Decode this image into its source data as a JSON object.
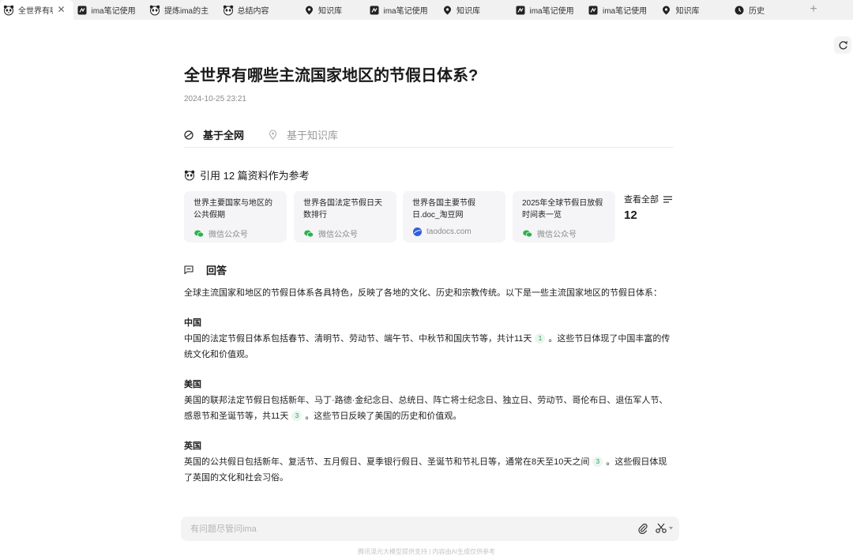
{
  "tabs": [
    {
      "label": "全世界有哪些主流国家地区的节假日体系？",
      "icon": "panda-icon",
      "active": true
    },
    {
      "label": "ima笔记使用指南",
      "icon": "note-icon"
    },
    {
      "label": "提炼ima的主要功能",
      "icon": "panda-icon"
    },
    {
      "label": "总结内容",
      "icon": "panda-icon"
    },
    {
      "label": "知识库",
      "icon": "pin-icon"
    },
    {
      "label": "ima笔记使用指南",
      "icon": "note-icon"
    },
    {
      "label": "知识库",
      "icon": "pin-icon"
    },
    {
      "label": "ima笔记使用指南",
      "icon": "note-icon"
    },
    {
      "label": "ima笔记使用指南",
      "icon": "note-icon"
    },
    {
      "label": "知识库",
      "icon": "pin-icon"
    },
    {
      "label": "历史",
      "icon": "clock-icon"
    }
  ],
  "tab_close": "✕",
  "tab_add": "+",
  "page": {
    "title": "全世界有哪些主流国家地区的节假日体系?",
    "date": "2024-10-25 23:21"
  },
  "source_tabs": {
    "web": "基于全网",
    "kb": "基于知识库"
  },
  "references": {
    "heading": "引用 12 篇资料作为参考",
    "cards": [
      {
        "title": "世界主要国家与地区的公共假期",
        "source": "微信公众号",
        "source_icon": "wechat-icon"
      },
      {
        "title": "世界各国法定节假日天数排行",
        "source": "微信公众号",
        "source_icon": "wechat-icon"
      },
      {
        "title": "世界各国主要节假日.doc_淘豆网",
        "source": "taodocs.com",
        "source_icon": "globe-icon"
      },
      {
        "title": "2025年全球节假日放假时间表一览",
        "source": "微信公众号",
        "source_icon": "wechat-icon"
      }
    ],
    "view_all_label": "查看全部",
    "view_all_count": "12"
  },
  "answer": {
    "heading": "回答",
    "intro": "全球主流国家和地区的节假日体系各具特色，反映了各地的文化、历史和宗教传统。以下是一些主流国家地区的节假日体系：",
    "sections": [
      {
        "country": "中国",
        "text_before": "中国的法定节假日体系包括春节、清明节、劳动节、端午节、中秋节和国庆节等，共计11天",
        "cite": "1",
        "text_after": "。这些节日体现了中国丰富的传统文化和价值观。"
      },
      {
        "country": "美国",
        "text_before": "美国的联邦法定节假日包括新年、马丁·路德·金纪念日、总统日、阵亡将士纪念日、独立日、劳动节、哥伦布日、退伍军人节、感恩节和圣诞节等，共11天",
        "cite": "3",
        "text_after": "。这些节日反映了美国的历史和价值观。"
      },
      {
        "country": "英国",
        "text_before": "英国的公共假日包括新年、复活节、五月假日、夏季银行假日、圣诞节和节礼日等，通常在8天至10天之间",
        "cite": "3",
        "text_after": "。这些假日体现了英国的文化和社会习俗。"
      }
    ]
  },
  "chat": {
    "placeholder": "有问题尽管问ima"
  },
  "footer": "腾讯混元大模型提供支持 | 内容由AI生成仅供参考",
  "colors": {
    "tabbar_bg": "#f1f1f2",
    "card_bg": "#f5f5f7",
    "cite_bg": "#e8f6ee",
    "cite_fg": "#2a9b5a",
    "wechat_green": "#2bb24c",
    "globe_blue": "#2f5fe0"
  }
}
